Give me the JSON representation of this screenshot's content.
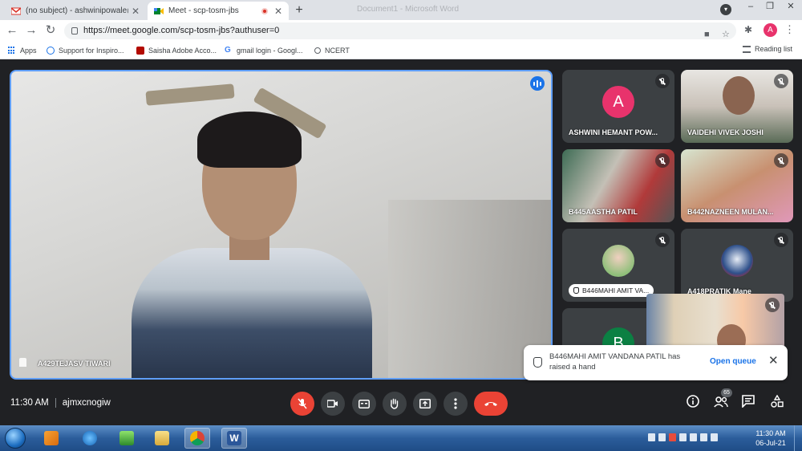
{
  "browser": {
    "tabs": [
      {
        "title": "(no subject) - ashwinipowale@m",
        "icon": "gmail-icon"
      },
      {
        "title": "Meet - scp-tosm-jbs",
        "icon": "meet-icon",
        "recording": true
      }
    ],
    "background_window_title": "Document1 - Microsoft Word",
    "url": "https://meet.google.com/scp-tosm-jbs?authuser=0",
    "profile_initial": "A",
    "bookmarks": [
      {
        "label": "Apps",
        "icon": "apps-grid-icon"
      },
      {
        "label": "Support for Inspiro...",
        "icon": "globe-icon"
      },
      {
        "label": "Saisha Adobe Acco...",
        "icon": "adobe-icon"
      },
      {
        "label": "gmail login - Googl...",
        "icon": "google-icon"
      },
      {
        "label": "NCERT",
        "icon": "ncert-icon"
      }
    ],
    "reading_list": "Reading list"
  },
  "meet": {
    "main_speaker": {
      "name": "A429TEJASV TIWARI"
    },
    "participants": [
      {
        "name": "ASHWINI HEMANT POW...",
        "avatar_letter": "A",
        "avatar_color": "#e8336c"
      },
      {
        "name": "VAIDEHI VIVEK JOSHI"
      },
      {
        "name": "B445AASTHA PATIL"
      },
      {
        "name": "B442NAZNEEN MULAN..."
      },
      {
        "name": "B446MAHI AMIT VA...",
        "hand_raised": true
      },
      {
        "name": "A418PRATIK Mane"
      },
      {
        "name": "",
        "avatar_letter": "B",
        "avatar_color": "#0b8043"
      }
    ],
    "notification": {
      "message": "B446MAHI AMIT VANDANA PATIL has raised a hand",
      "action": "Open queue"
    },
    "time": "11:30 AM",
    "meeting_code": "ajmxcnogiw",
    "participant_count": "65"
  },
  "taskbar": {
    "time": "11:30 AM",
    "date": "06-Jul-21"
  }
}
